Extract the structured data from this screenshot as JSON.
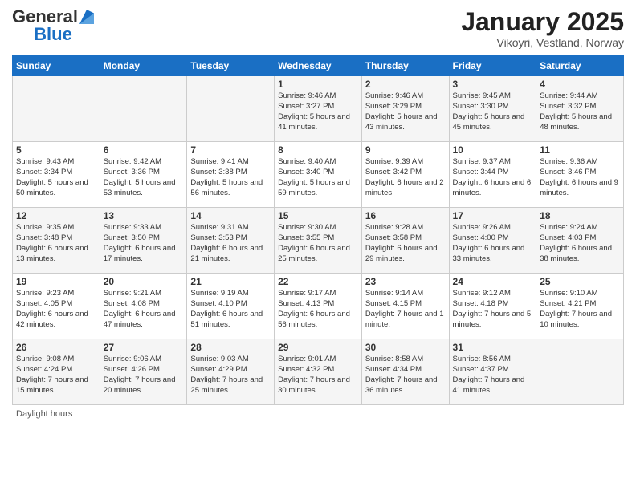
{
  "header": {
    "logo_general": "General",
    "logo_blue": "Blue",
    "main_title": "January 2025",
    "subtitle": "Vikoyri, Vestland, Norway"
  },
  "days_of_week": [
    "Sunday",
    "Monday",
    "Tuesday",
    "Wednesday",
    "Thursday",
    "Friday",
    "Saturday"
  ],
  "weeks": [
    [
      {
        "day": "",
        "info": ""
      },
      {
        "day": "",
        "info": ""
      },
      {
        "day": "",
        "info": ""
      },
      {
        "day": "1",
        "info": "Sunrise: 9:46 AM\nSunset: 3:27 PM\nDaylight: 5 hours and 41 minutes."
      },
      {
        "day": "2",
        "info": "Sunrise: 9:46 AM\nSunset: 3:29 PM\nDaylight: 5 hours and 43 minutes."
      },
      {
        "day": "3",
        "info": "Sunrise: 9:45 AM\nSunset: 3:30 PM\nDaylight: 5 hours and 45 minutes."
      },
      {
        "day": "4",
        "info": "Sunrise: 9:44 AM\nSunset: 3:32 PM\nDaylight: 5 hours and 48 minutes."
      }
    ],
    [
      {
        "day": "5",
        "info": "Sunrise: 9:43 AM\nSunset: 3:34 PM\nDaylight: 5 hours and 50 minutes."
      },
      {
        "day": "6",
        "info": "Sunrise: 9:42 AM\nSunset: 3:36 PM\nDaylight: 5 hours and 53 minutes."
      },
      {
        "day": "7",
        "info": "Sunrise: 9:41 AM\nSunset: 3:38 PM\nDaylight: 5 hours and 56 minutes."
      },
      {
        "day": "8",
        "info": "Sunrise: 9:40 AM\nSunset: 3:40 PM\nDaylight: 5 hours and 59 minutes."
      },
      {
        "day": "9",
        "info": "Sunrise: 9:39 AM\nSunset: 3:42 PM\nDaylight: 6 hours and 2 minutes."
      },
      {
        "day": "10",
        "info": "Sunrise: 9:37 AM\nSunset: 3:44 PM\nDaylight: 6 hours and 6 minutes."
      },
      {
        "day": "11",
        "info": "Sunrise: 9:36 AM\nSunset: 3:46 PM\nDaylight: 6 hours and 9 minutes."
      }
    ],
    [
      {
        "day": "12",
        "info": "Sunrise: 9:35 AM\nSunset: 3:48 PM\nDaylight: 6 hours and 13 minutes."
      },
      {
        "day": "13",
        "info": "Sunrise: 9:33 AM\nSunset: 3:50 PM\nDaylight: 6 hours and 17 minutes."
      },
      {
        "day": "14",
        "info": "Sunrise: 9:31 AM\nSunset: 3:53 PM\nDaylight: 6 hours and 21 minutes."
      },
      {
        "day": "15",
        "info": "Sunrise: 9:30 AM\nSunset: 3:55 PM\nDaylight: 6 hours and 25 minutes."
      },
      {
        "day": "16",
        "info": "Sunrise: 9:28 AM\nSunset: 3:58 PM\nDaylight: 6 hours and 29 minutes."
      },
      {
        "day": "17",
        "info": "Sunrise: 9:26 AM\nSunset: 4:00 PM\nDaylight: 6 hours and 33 minutes."
      },
      {
        "day": "18",
        "info": "Sunrise: 9:24 AM\nSunset: 4:03 PM\nDaylight: 6 hours and 38 minutes."
      }
    ],
    [
      {
        "day": "19",
        "info": "Sunrise: 9:23 AM\nSunset: 4:05 PM\nDaylight: 6 hours and 42 minutes."
      },
      {
        "day": "20",
        "info": "Sunrise: 9:21 AM\nSunset: 4:08 PM\nDaylight: 6 hours and 47 minutes."
      },
      {
        "day": "21",
        "info": "Sunrise: 9:19 AM\nSunset: 4:10 PM\nDaylight: 6 hours and 51 minutes."
      },
      {
        "day": "22",
        "info": "Sunrise: 9:17 AM\nSunset: 4:13 PM\nDaylight: 6 hours and 56 minutes."
      },
      {
        "day": "23",
        "info": "Sunrise: 9:14 AM\nSunset: 4:15 PM\nDaylight: 7 hours and 1 minute."
      },
      {
        "day": "24",
        "info": "Sunrise: 9:12 AM\nSunset: 4:18 PM\nDaylight: 7 hours and 5 minutes."
      },
      {
        "day": "25",
        "info": "Sunrise: 9:10 AM\nSunset: 4:21 PM\nDaylight: 7 hours and 10 minutes."
      }
    ],
    [
      {
        "day": "26",
        "info": "Sunrise: 9:08 AM\nSunset: 4:24 PM\nDaylight: 7 hours and 15 minutes."
      },
      {
        "day": "27",
        "info": "Sunrise: 9:06 AM\nSunset: 4:26 PM\nDaylight: 7 hours and 20 minutes."
      },
      {
        "day": "28",
        "info": "Sunrise: 9:03 AM\nSunset: 4:29 PM\nDaylight: 7 hours and 25 minutes."
      },
      {
        "day": "29",
        "info": "Sunrise: 9:01 AM\nSunset: 4:32 PM\nDaylight: 7 hours and 30 minutes."
      },
      {
        "day": "30",
        "info": "Sunrise: 8:58 AM\nSunset: 4:34 PM\nDaylight: 7 hours and 36 minutes."
      },
      {
        "day": "31",
        "info": "Sunrise: 8:56 AM\nSunset: 4:37 PM\nDaylight: 7 hours and 41 minutes."
      },
      {
        "day": "",
        "info": ""
      }
    ]
  ],
  "footer": {
    "daylight_label": "Daylight hours"
  }
}
